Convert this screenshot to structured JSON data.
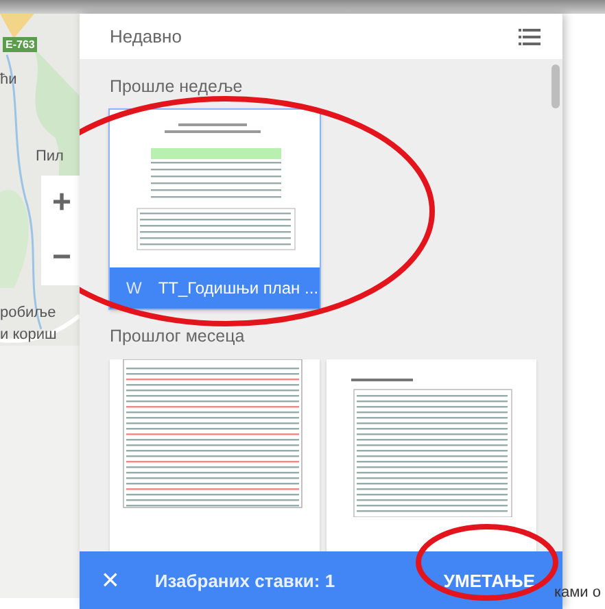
{
  "map": {
    "road_badge": "E-763",
    "labels": [
      "ћи",
      "Пил",
      "робиље",
      "и кориш"
    ],
    "zoom_in": "+",
    "zoom_out": "−"
  },
  "picker": {
    "title": "Недавно",
    "sections": [
      {
        "heading": "Прошле недеље",
        "files": [
          {
            "kind": "table-doc",
            "name": "TT_Годишњи план ...",
            "type_letter": "W",
            "selected": true
          }
        ]
      },
      {
        "heading": "Прошлог месеца",
        "files": [
          {
            "kind": "list-doc",
            "selected": false
          },
          {
            "kind": "roster-doc",
            "selected": false
          }
        ]
      }
    ],
    "action_bar": {
      "close": "×",
      "count": "Изабраних ставки: 1",
      "insert": "УМЕТАЊЕ"
    }
  },
  "background_text": "ками о"
}
